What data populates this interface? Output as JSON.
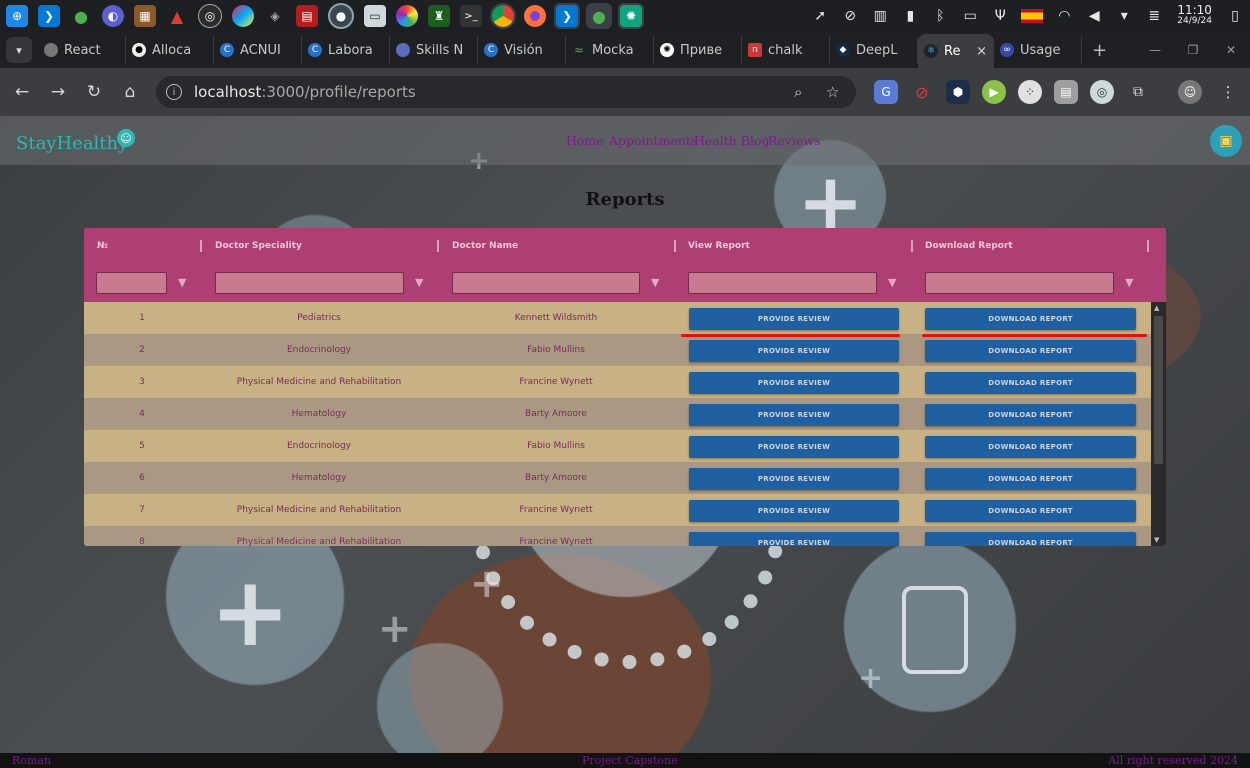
{
  "os": {
    "clock_time": "11:10",
    "clock_date": "24/9/24",
    "taskbar_apps": [
      "app-hub",
      "vscode",
      "mongodb",
      "mullvad",
      "minecraft",
      "git-tool",
      "obs",
      "color-app",
      "gimp",
      "filezilla",
      "generic-app",
      "files",
      "pinwheel",
      "devtool",
      "terminal",
      "chrome",
      "firefox",
      "vscode-2",
      "mongodb-2",
      "chatgpt"
    ]
  },
  "browser": {
    "tabs": [
      {
        "label": "React",
        "icon": "globe"
      },
      {
        "label": "Alloca",
        "icon": "github"
      },
      {
        "label": "ACNUI",
        "icon": "coursera"
      },
      {
        "label": "Labora",
        "icon": "coursera"
      },
      {
        "label": "Skills N",
        "icon": "globe"
      },
      {
        "label": "Visión",
        "icon": "coursera"
      },
      {
        "label": "Mocka",
        "icon": "mockaroo"
      },
      {
        "label": "Приве",
        "icon": "chatgpt"
      },
      {
        "label": "chalk",
        "icon": "npm"
      },
      {
        "label": "DeepL",
        "icon": "deepl"
      },
      {
        "label": "Re",
        "icon": "react",
        "active": true
      },
      {
        "label": "Usage",
        "icon": "usage"
      }
    ],
    "close_glyph": "×",
    "new_tab_glyph": "+",
    "url_host": "localhost",
    "url_path": ":3000/profile/reports"
  },
  "app": {
    "brand": "StayHealthy",
    "nav": [
      "Home",
      "Appointments",
      "Health Blog",
      "Reviews"
    ],
    "page_title": "Reports",
    "table": {
      "headers": [
        "№",
        "Doctor Speciality",
        "Doctor Name",
        "View Report",
        "Download Report"
      ],
      "rows": [
        {
          "n": "1",
          "speciality": "Pediatrics",
          "name": "Kennett Wildsmith"
        },
        {
          "n": "2",
          "speciality": "Endocrinology",
          "name": "Fabio Mullins"
        },
        {
          "n": "3",
          "speciality": "Physical Medicine and Rehabilitation",
          "name": "Francine Wynett"
        },
        {
          "n": "4",
          "speciality": "Hematology",
          "name": "Barty Amoore"
        },
        {
          "n": "5",
          "speciality": "Endocrinology",
          "name": "Fabio Mullins"
        },
        {
          "n": "6",
          "speciality": "Hematology",
          "name": "Barty Amoore"
        },
        {
          "n": "7",
          "speciality": "Physical Medicine and Rehabilitation",
          "name": "Francine Wynett"
        },
        {
          "n": "8",
          "speciality": "Physical Medicine and Rehabilitation",
          "name": "Francine Wynett"
        }
      ],
      "view_button": "PROVIDE REVIEW",
      "download_button": "DOWNLOAD REPORT"
    },
    "footer": {
      "left": "Roman",
      "center": "Project Capstone",
      "right": "All right reserved 2024"
    },
    "colors": {
      "brand": "#2fb7b0",
      "nav": "#7b1c8c",
      "header": "#ad3f72",
      "button": "#205fa0",
      "annotation": "#e0120f"
    }
  }
}
